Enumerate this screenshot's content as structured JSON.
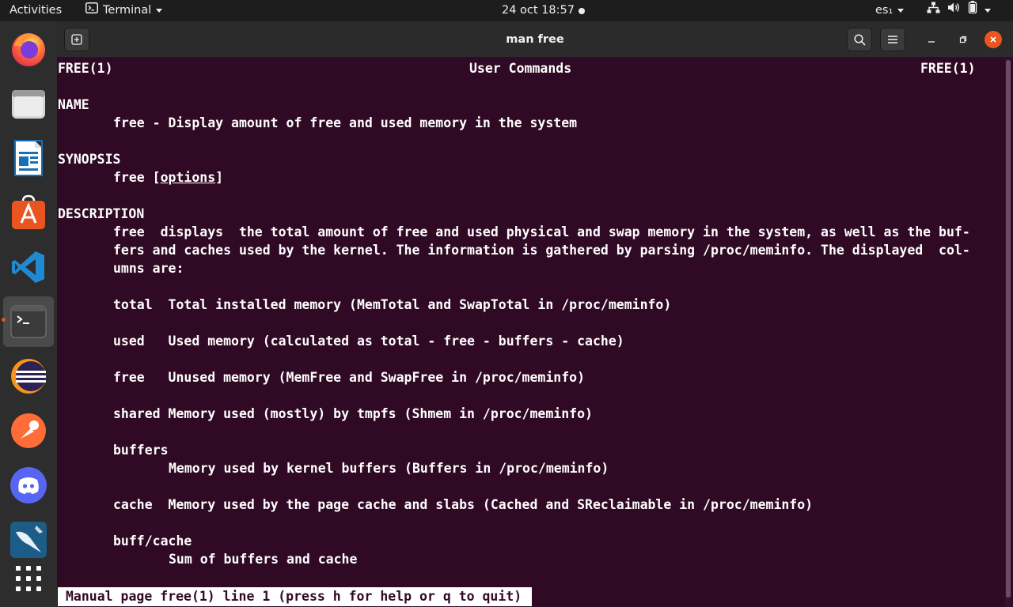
{
  "topbar": {
    "activities": "Activities",
    "app_name": "Terminal",
    "clock": "24 oct  18:57",
    "keyboard_layout": "es₁"
  },
  "dock": {
    "items": [
      {
        "icon": "firefox-icon"
      },
      {
        "icon": "files-icon"
      },
      {
        "icon": "libreoffice-writer-icon"
      },
      {
        "icon": "software-center-icon"
      },
      {
        "icon": "vscode-icon"
      },
      {
        "icon": "terminal-icon",
        "active": true
      },
      {
        "icon": "eclipse-icon"
      },
      {
        "icon": "postman-icon"
      },
      {
        "icon": "discord-icon"
      },
      {
        "icon": "mysql-workbench-icon"
      },
      {
        "icon": "show-applications-icon"
      }
    ]
  },
  "window": {
    "title": "man free"
  },
  "terminal": {
    "header_left": "FREE(1)",
    "header_center": "User Commands",
    "header_right": "FREE(1)",
    "name_heading": "NAME",
    "name_text": "free - Display amount of free and used memory in the system",
    "synopsis_heading": "SYNOPSIS",
    "synopsis_cmd": "free [",
    "synopsis_opt": "options",
    "synopsis_end": "]",
    "description_heading": "DESCRIPTION",
    "desc_line1": "free  displays  the total amount of free and used physical and swap memory in the system, as well as the buf‐",
    "desc_line2": "fers and caches used by the kernel. The information is gathered by parsing /proc/meminfo. The displayed  col‐",
    "desc_line3": "umns are:",
    "total_line": "total  Total installed memory (MemTotal and SwapTotal in /proc/meminfo)",
    "used_line": "used   Used memory (calculated as total - free - buffers - cache)",
    "free_line": "free   Unused memory (MemFree and SwapFree in /proc/meminfo)",
    "shared_line": "shared Memory used (mostly) by tmpfs (Shmem in /proc/meminfo)",
    "buffers_term": "buffers",
    "buffers_desc": "Memory used by kernel buffers (Buffers in /proc/meminfo)",
    "cache_line": "cache  Memory used by the page cache and slabs (Cached and SReclaimable in /proc/meminfo)",
    "buffcache_term": "buff/cache",
    "buffcache_desc": "Sum of buffers and cache",
    "status_line": "Manual page free(1) line 1 (press h for help or q to quit)"
  },
  "colors": {
    "terminal_bg": "#300a24",
    "accent": "#e95420"
  }
}
